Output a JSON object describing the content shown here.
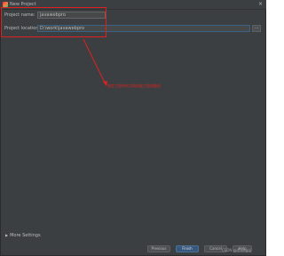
{
  "window": {
    "title": "New Project",
    "close_glyph": "×"
  },
  "form": {
    "project_name_label": "Project name:",
    "project_name_value": "javawebpro",
    "project_location_label": "Project location:",
    "project_location_value": "D:\\work\\javawebpro",
    "browse_label": "..."
  },
  "annotation": {
    "text": "指定工程的名字和存放工程的路径",
    "color": "#e02020"
  },
  "more_settings": {
    "label": "More Settings",
    "arrow_glyph": "▶"
  },
  "footer": {
    "previous_label": "Previous",
    "finish_label": "Finish",
    "cancel_label": "Cancel",
    "help_label": "Help"
  },
  "watermark": "CSDN @ithongqi"
}
